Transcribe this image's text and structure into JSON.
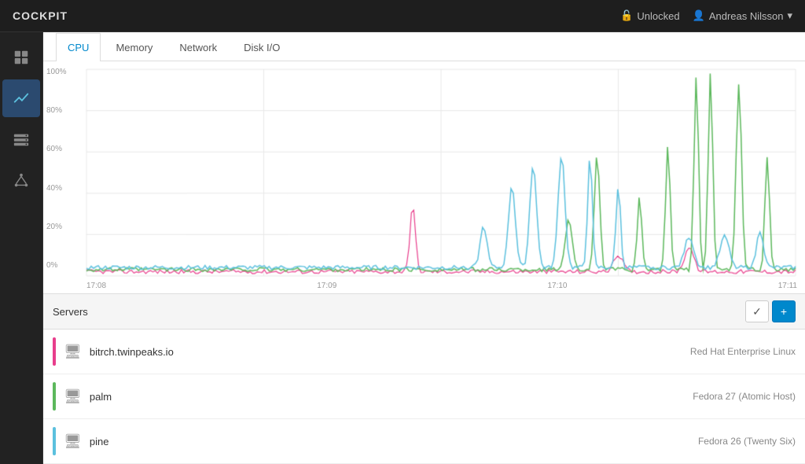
{
  "app": {
    "title": "COCKPIT"
  },
  "topbar": {
    "unlock_label": "Unlocked",
    "user_label": "Andreas Nilsson",
    "dropdown_arrow": "▾"
  },
  "tabs": [
    {
      "id": "cpu",
      "label": "CPU",
      "active": true
    },
    {
      "id": "memory",
      "label": "Memory",
      "active": false
    },
    {
      "id": "network",
      "label": "Network",
      "active": false
    },
    {
      "id": "disk",
      "label": "Disk I/O",
      "active": false
    }
  ],
  "chart": {
    "y_labels": [
      "100%",
      "80%",
      "60%",
      "40%",
      "20%",
      "0%"
    ],
    "x_labels": [
      "17:08",
      "17:09",
      "17:10",
      "17:11"
    ]
  },
  "servers": {
    "panel_label": "Servers",
    "check_button_label": "✓",
    "add_button_label": "+",
    "rows": [
      {
        "name": "bitrch.twinpeaks.io",
        "os": "Red Hat Enterprise Linux",
        "color": "#e83e8c"
      },
      {
        "name": "palm",
        "os": "Fedora 27 (Atomic Host)",
        "color": "#5cb85c"
      },
      {
        "name": "pine",
        "os": "Fedora 26 (Twenty Six)",
        "color": "#5bc0de"
      }
    ]
  }
}
